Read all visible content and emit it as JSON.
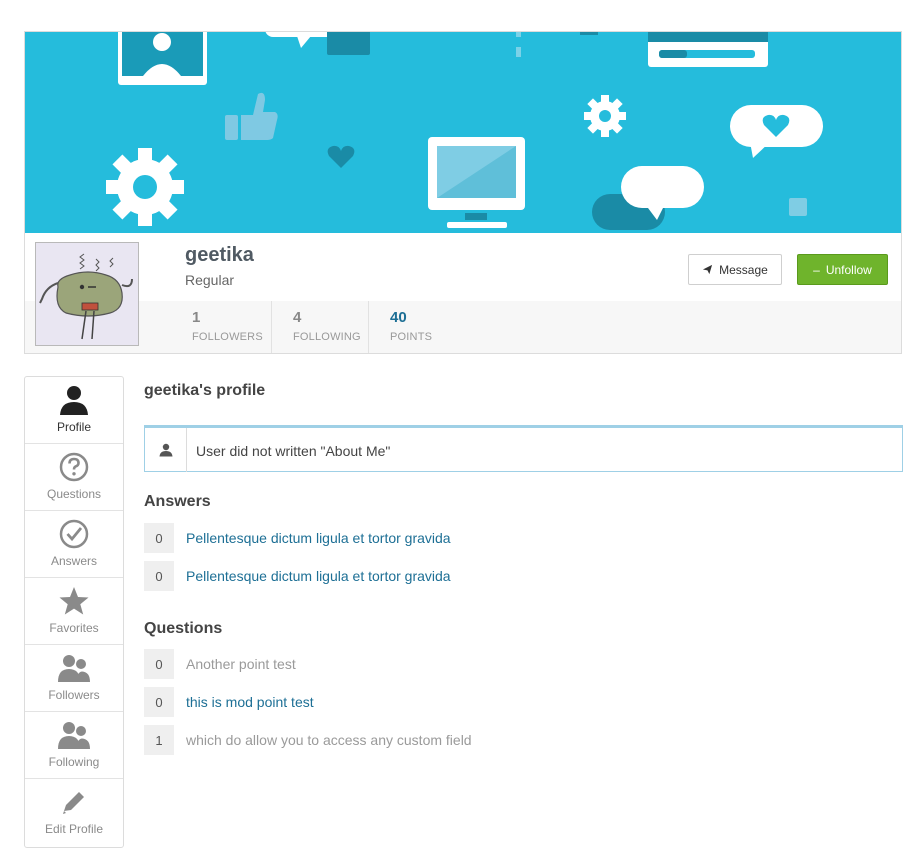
{
  "profile": {
    "username": "geetika",
    "role": "Regular",
    "message_label": "Message",
    "unfollow_label": "Unfollow",
    "stats": [
      {
        "value": "1",
        "label": "FOLLOWERS"
      },
      {
        "value": "4",
        "label": "FOLLOWING"
      },
      {
        "value": "40",
        "label": "POINTS"
      }
    ]
  },
  "sidebar": {
    "items": [
      {
        "label": "Profile",
        "icon": "user-icon"
      },
      {
        "label": "Questions",
        "icon": "question-circle-icon"
      },
      {
        "label": "Answers",
        "icon": "check-circle-icon"
      },
      {
        "label": "Favorites",
        "icon": "star-icon"
      },
      {
        "label": "Followers",
        "icon": "users-icon"
      },
      {
        "label": "Following",
        "icon": "users-icon"
      },
      {
        "label": "Edit Profile",
        "icon": "pencil-icon"
      }
    ]
  },
  "main": {
    "title": "geetika's profile",
    "about": "User did not written \"About Me\"",
    "answers_title": "Answers",
    "answers": [
      {
        "count": "0",
        "text": "Pellentesque dictum ligula et tortor gravida"
      },
      {
        "count": "0",
        "text": "Pellentesque dictum ligula et tortor gravida"
      }
    ],
    "questions_title": "Questions",
    "questions": [
      {
        "count": "0",
        "text": "Another point test"
      },
      {
        "count": "0",
        "text": "this is mod point test"
      },
      {
        "count": "1",
        "text": "which do allow you to access any custom field"
      }
    ]
  },
  "colors": {
    "cover": "#25bcdc",
    "unfollow_button": "#6fb42c",
    "link": "#1d6f95",
    "points": "#1d6f95"
  }
}
